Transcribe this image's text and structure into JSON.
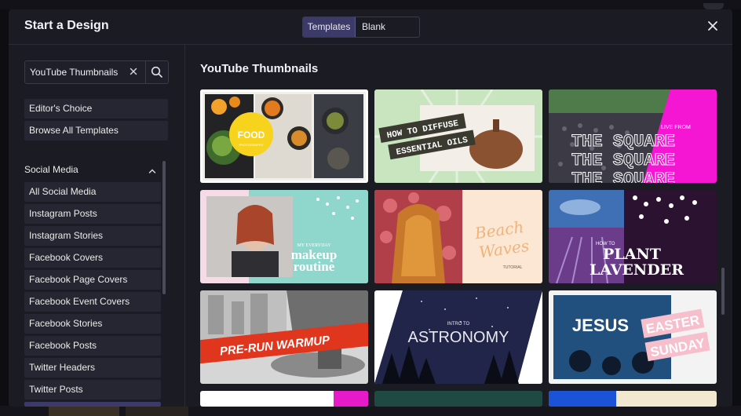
{
  "modal": {
    "title": "Start a Design",
    "tabs": [
      "Templates",
      "Blank Canvas"
    ],
    "active_tab": "Templates"
  },
  "search": {
    "value": "YouTube Thumbnails"
  },
  "sidebar": {
    "top_items": [
      "Editor's Choice",
      "Browse All Templates"
    ],
    "section_title": "Social Media",
    "section_items": [
      "All Social Media",
      "Instagram Posts",
      "Instagram Stories",
      "Facebook Covers",
      "Facebook Page Covers",
      "Facebook Event Covers",
      "Facebook Stories",
      "Facebook Posts",
      "Twitter Headers",
      "Twitter Posts"
    ]
  },
  "content": {
    "title": "YouTube Thumbnails",
    "templates": [
      {
        "id": "food",
        "lines": [
          "FOOD",
          "PHOTOGRAPHY"
        ]
      },
      {
        "id": "oils",
        "lines": [
          "HOW TO DIFFUSE",
          "ESSENTIAL OILS"
        ]
      },
      {
        "id": "square",
        "lines": [
          "LIVE FROM",
          "THE SQUARE"
        ]
      },
      {
        "id": "makeup",
        "lines": [
          "MY EVERYDAY",
          "makeup",
          "routine"
        ]
      },
      {
        "id": "waves",
        "lines": [
          "Beach",
          "Waves",
          "TUTORIAL"
        ]
      },
      {
        "id": "lavender",
        "lines": [
          "HOW TO",
          "PLANT",
          "LAVENDER"
        ]
      },
      {
        "id": "warmup",
        "lines": [
          "PRE-RUN WARMUP"
        ]
      },
      {
        "id": "astro",
        "lines": [
          "INTRO TO",
          "ASTRONOMY"
        ]
      },
      {
        "id": "easter",
        "lines": [
          "JESUS",
          "EASTER",
          "SUNDAY"
        ]
      }
    ]
  },
  "colors": {
    "accent": "#3b3a68",
    "background": "#1b1b24",
    "item": "#262633"
  }
}
